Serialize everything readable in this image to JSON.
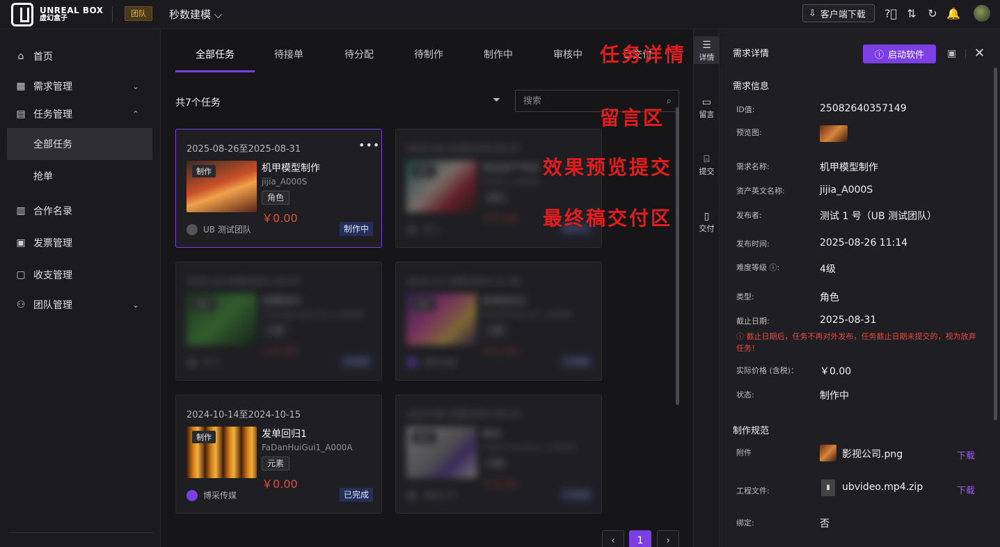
{
  "topbar": {
    "logo_en": "UNREAL BOX",
    "logo_cn": "虚幻盒子",
    "team_badge": "团队",
    "team_name": "秒数建模",
    "download_label": "客户端下载"
  },
  "sidebar": {
    "items": [
      {
        "label": "首页",
        "icon": "home-icon"
      },
      {
        "label": "需求管理",
        "icon": "table-icon"
      },
      {
        "label": "任务管理",
        "icon": "clipboard-icon"
      },
      {
        "label": "全部任务"
      },
      {
        "label": "抢单"
      },
      {
        "label": "合作名录",
        "icon": "book-icon"
      },
      {
        "label": "发票管理",
        "icon": "invoice-icon"
      },
      {
        "label": "收支管理",
        "icon": "wallet-icon"
      },
      {
        "label": "团队管理",
        "icon": "team-icon"
      }
    ]
  },
  "tabs": [
    "全部任务",
    "待接单",
    "待分配",
    "待制作",
    "制作中",
    "审核中",
    "已交付"
  ],
  "task_count": "共7个任务",
  "search_placeholder": "搜索",
  "cards": [
    {
      "date": "2025-08-26至2025-08-31",
      "tag": "制作",
      "title": "机甲模型制作",
      "code": "jijia_A000S",
      "type": "角色",
      "price": "￥0.00",
      "team": "UB 测试团队",
      "status": "制作中"
    },
    {
      "date": "2025-04-10至2024-04-27",
      "tag": "制作",
      "title": "测试资产同步",
      "code": "CESHI_A000B",
      "type": "角色",
      "price": "￥0.00",
      "team": "阿飞",
      "status": "制作中"
    },
    {
      "date": "2025-03-06至2025-03-07",
      "tag": "制作",
      "title": "场景回归",
      "code": "ChangJingHuiGui_A000B",
      "type": "元素",
      "price": "￥0.00",
      "team": "阿飞",
      "status": "已完成"
    },
    {
      "date": "2024-11-28至2024-11-30",
      "tag": "制作",
      "title": "发单回归2",
      "code": "FaDanHuiGui2_A000B",
      "type": "元素",
      "price": "￥0.00",
      "team": "博采传媒",
      "status": "已完成"
    },
    {
      "date": "2024-10-14至2024-10-15",
      "tag": "制作",
      "title": "发单回归1",
      "code": "FaDanHuiGui1_A000A",
      "type": "元素",
      "price": "￥0.00",
      "team": "博采传媒",
      "status": "已完成"
    },
    {
      "date": "2024-09-20至2024-09-23",
      "tag": "制作",
      "title": "测试",
      "code": "CeShiTianShou_A000B",
      "type": "元素",
      "price": "￥0.00",
      "team": "测试公司",
      "status": "已完成"
    }
  ],
  "pagination": {
    "current": "1",
    "prev": "‹",
    "next": "›"
  },
  "annotations": {
    "task_detail": "任务详情",
    "comments": "留言区",
    "preview_submit": "效果预览提交",
    "final_delivery": "最终稿交付区"
  },
  "rail": [
    {
      "label": "详情",
      "icon": "list-icon"
    },
    {
      "label": "留言",
      "icon": "comment-icon"
    },
    {
      "label": "提交",
      "icon": "folder-icon"
    },
    {
      "label": "交付",
      "icon": "document-icon"
    }
  ],
  "detail": {
    "title": "需求详情",
    "start_button": "启动软件",
    "section_info": "需求信息",
    "fields": [
      {
        "label": "ID值:",
        "value": "25082640357149"
      },
      {
        "label": "预览图:",
        "value": ""
      },
      {
        "label": "需求名称:",
        "value": "机甲模型制作"
      },
      {
        "label": "资产英文名称:",
        "value": "jijia_A000S"
      },
      {
        "label": "发布者:",
        "value": "测试 1 号（UB 测试团队）"
      },
      {
        "label": "发布时间:",
        "value": "2025-08-26 11:14"
      },
      {
        "label": "难度等级 ⓘ:",
        "value": "4级"
      },
      {
        "label": "类型:",
        "value": "角色"
      },
      {
        "label": "截止日期:",
        "value": "2025-08-31"
      },
      {
        "label": "实际价格 (含税)：",
        "value": "￥0.00"
      },
      {
        "label": "状态:",
        "value": "制作中"
      }
    ],
    "warning": "ⓘ 截止日期后，任务不再对外发布，任务截止日期未提交的，视为放弃任务！",
    "section_spec": "制作规范",
    "attachment_label": "附件",
    "attachment_file": "影视公司.png",
    "project_label": "工程文件:",
    "project_file": "ubvideo.mp4.zip",
    "download": "下载",
    "bind_label": "绑定:",
    "bind_value": "否"
  }
}
